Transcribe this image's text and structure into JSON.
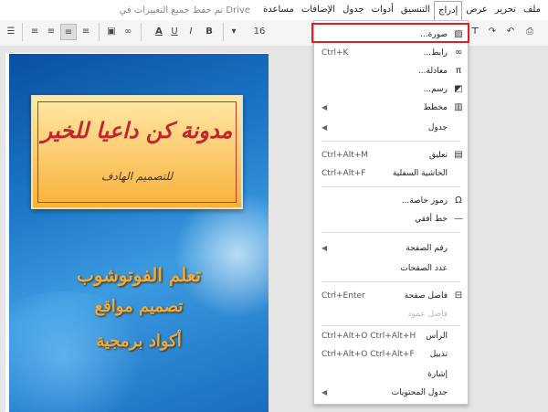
{
  "menubar": {
    "items": [
      "ملف",
      "تحرير",
      "عرض",
      "إدراج",
      "التنسيق",
      "أدوات",
      "جدول",
      "الإضافات",
      "مساعدة"
    ],
    "active_index": 3,
    "save_status": "تم حفظ جميع التغييرات في Drive"
  },
  "toolbar": {
    "font_size": "16",
    "bold": "B",
    "italic": "I",
    "underline": "U",
    "text_color": "A"
  },
  "document": {
    "banner_title": "مدونة كن داعيا للخير",
    "banner_subtitle": "للتصميم الهادف",
    "lines": [
      "تعلم الفوتوشوب",
      "تصميم مواقع",
      "أكواد برمجية"
    ]
  },
  "insert_menu": {
    "items": [
      {
        "label": "صورة...",
        "shortcut": "",
        "icon": "image-icon",
        "submenu": false,
        "disabled": false
      },
      {
        "label": "رابط...",
        "shortcut": "Ctrl+K",
        "icon": "link-icon",
        "submenu": false,
        "disabled": false
      },
      {
        "label": "معادلة...",
        "shortcut": "",
        "icon": "pi-icon",
        "submenu": false,
        "disabled": false
      },
      {
        "label": "رسم...",
        "shortcut": "",
        "icon": "drawing-icon",
        "submenu": false,
        "disabled": false
      },
      {
        "label": "مخطط",
        "shortcut": "",
        "icon": "chart-icon",
        "submenu": true,
        "disabled": false
      },
      {
        "label": "جدول",
        "shortcut": "",
        "icon": "",
        "submenu": true,
        "disabled": false
      },
      {
        "label": "تعليق",
        "shortcut": "Ctrl+Alt+M",
        "icon": "comment-icon",
        "submenu": false,
        "disabled": false
      },
      {
        "label": "الحاشية السفلية",
        "shortcut": "Ctrl+Alt+F",
        "icon": "",
        "submenu": false,
        "disabled": false
      },
      {
        "label": "رموز خاصة...",
        "shortcut": "",
        "icon": "omega-icon",
        "submenu": false,
        "disabled": false
      },
      {
        "label": "خط أفقي",
        "shortcut": "",
        "icon": "hr-icon",
        "submenu": false,
        "disabled": false
      },
      {
        "label": "رقم الصفحة",
        "shortcut": "",
        "icon": "",
        "submenu": true,
        "disabled": false
      },
      {
        "label": "عدد الصفحات",
        "shortcut": "",
        "icon": "",
        "submenu": false,
        "disabled": false
      },
      {
        "label": "فاصل صفحة",
        "shortcut": "Ctrl+Enter",
        "icon": "page-break-icon",
        "submenu": false,
        "disabled": false
      },
      {
        "label": "فاصل عمود",
        "shortcut": "",
        "icon": "",
        "submenu": false,
        "disabled": true
      },
      {
        "label": "الرأس",
        "shortcut": "Ctrl+Alt+O Ctrl+Alt+H",
        "icon": "",
        "submenu": false,
        "disabled": false
      },
      {
        "label": "تذييل",
        "shortcut": "Ctrl+Alt+O Ctrl+Alt+F",
        "icon": "",
        "submenu": false,
        "disabled": false
      },
      {
        "label": "إشارة",
        "shortcut": "",
        "icon": "",
        "submenu": false,
        "disabled": false
      },
      {
        "label": "جدول المحتويات",
        "shortcut": "",
        "icon": "",
        "submenu": true,
        "disabled": false
      }
    ]
  },
  "highlight": "#e02020"
}
